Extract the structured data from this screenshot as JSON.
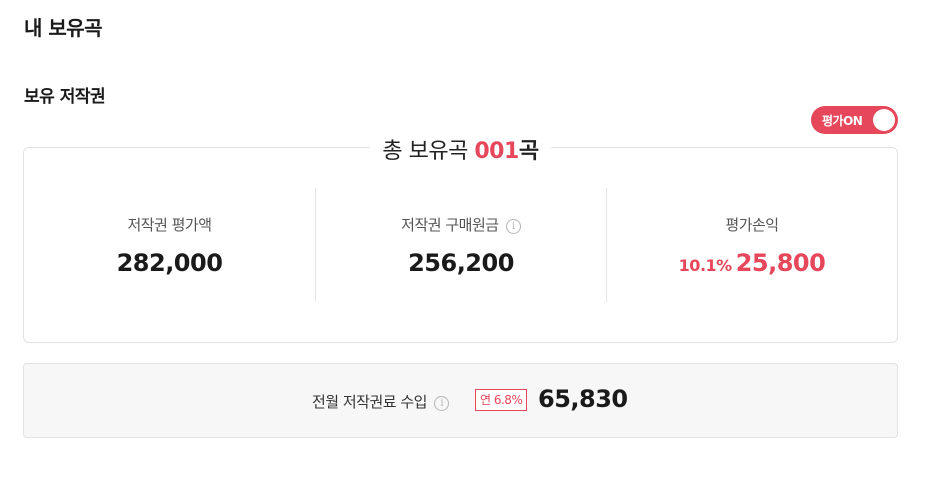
{
  "page": {
    "title": "내 보유곡"
  },
  "section": {
    "title": "보유 저작권"
  },
  "toggle": {
    "label": "평가ON",
    "on": true
  },
  "summary": {
    "total_prefix": "총 보유곡 ",
    "total_count": "001",
    "total_suffix": "곡",
    "stats": [
      {
        "label": "저작권 평가액",
        "value": "282,000"
      },
      {
        "label": "저작권 구매원금",
        "value": "256,200",
        "info": "i"
      },
      {
        "label": "평가손익",
        "rate": "10.1%",
        "value": "25,800"
      }
    ]
  },
  "income": {
    "label": "전월 저작권료 수입",
    "info": "i",
    "rate_badge": "연 6.8%",
    "value": "65,830"
  },
  "colors": {
    "accent": "#e6475a",
    "border": "#e2e2e2",
    "income_bg": "#f7f7f7"
  }
}
